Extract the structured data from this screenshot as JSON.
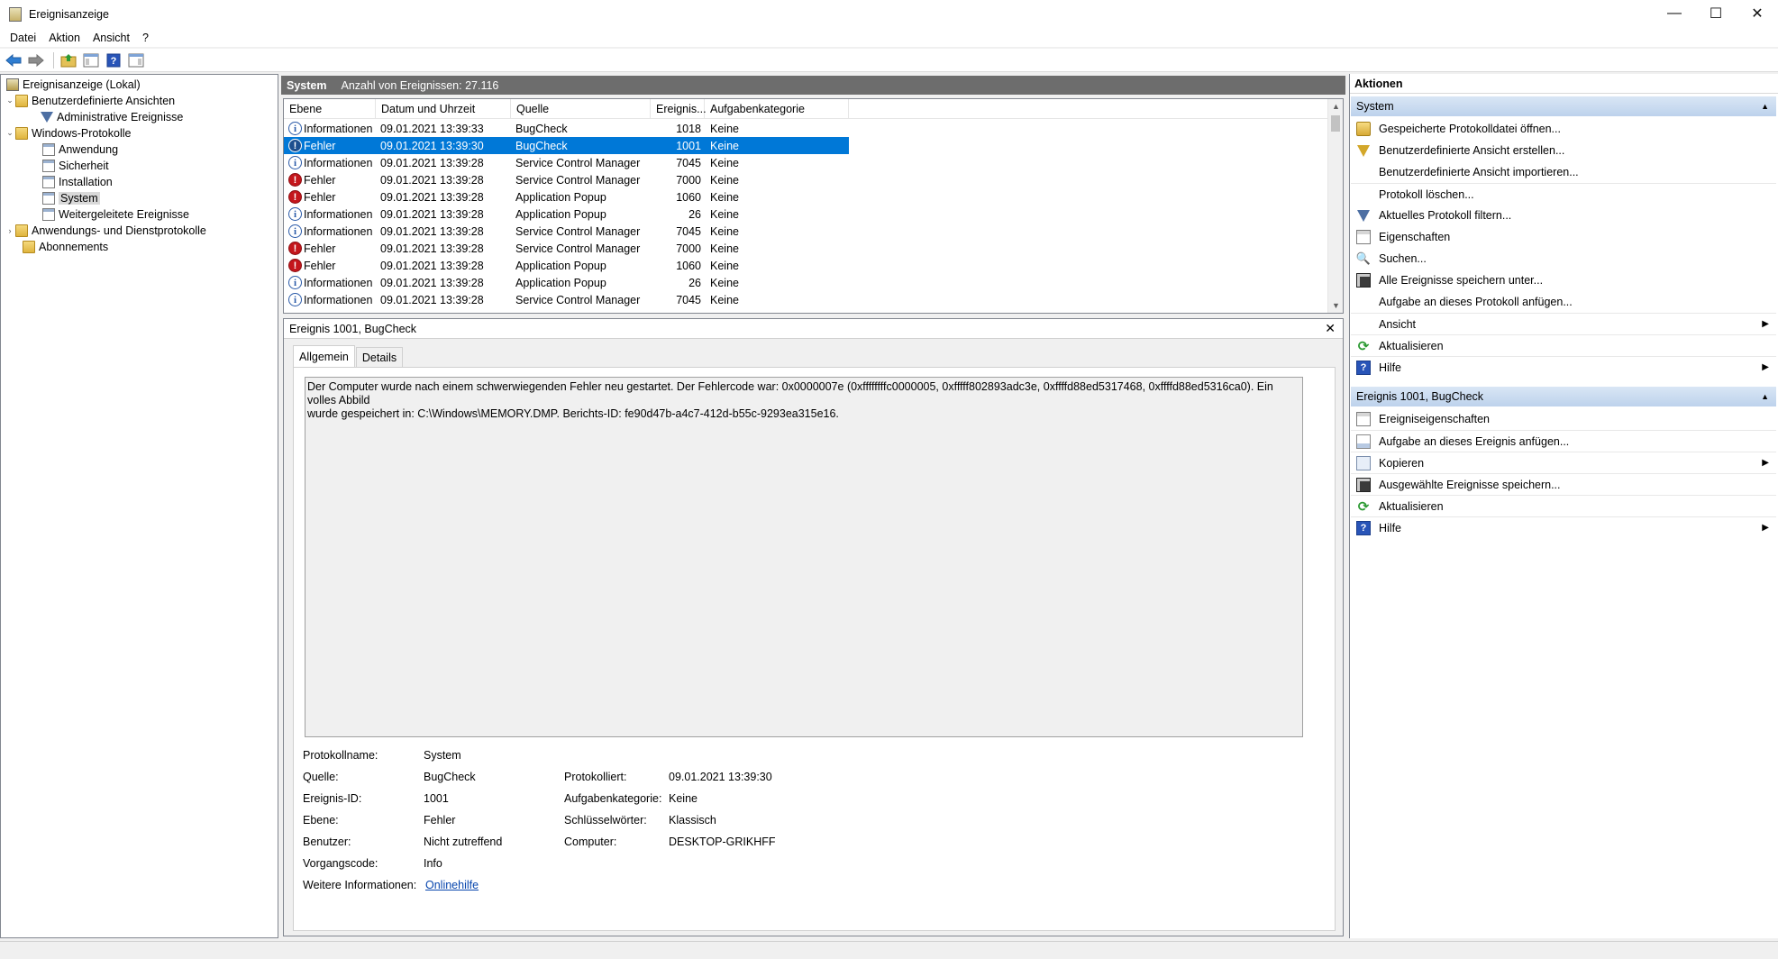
{
  "window": {
    "title": "Ereignisanzeige",
    "controls": [
      "—",
      "☐",
      "✕"
    ]
  },
  "menu": [
    "Datei",
    "Aktion",
    "Ansicht",
    "?"
  ],
  "tree": {
    "root": "Ereignisanzeige (Lokal)",
    "custom_views": "Benutzerdefinierte Ansichten",
    "admin_events": "Administrative Ereignisse",
    "windows_logs": "Windows-Protokolle",
    "application": "Anwendung",
    "security": "Sicherheit",
    "setup": "Installation",
    "system": "System",
    "forwarded": "Weitergeleitete Ereignisse",
    "app_service_logs": "Anwendungs- und Dienstprotokolle",
    "subscriptions": "Abonnements"
  },
  "center": {
    "title": "System",
    "count": "Anzahl von Ereignissen: 27.116"
  },
  "events": {
    "columns": [
      "Ebene",
      "Datum und Uhrzeit",
      "Quelle",
      "Ereignis...",
      "Aufgabenkategorie"
    ],
    "rows": [
      {
        "level": "Informationen",
        "type": "info",
        "date": "09.01.2021 13:39:33",
        "source": "BugCheck",
        "id": "1018",
        "category": "Keine"
      },
      {
        "level": "Fehler",
        "type": "error",
        "date": "09.01.2021 13:39:30",
        "source": "BugCheck",
        "id": "1001",
        "category": "Keine"
      },
      {
        "level": "Informationen",
        "type": "info",
        "date": "09.01.2021 13:39:28",
        "source": "Service Control Manager",
        "id": "7045",
        "category": "Keine"
      },
      {
        "level": "Fehler",
        "type": "error",
        "date": "09.01.2021 13:39:28",
        "source": "Service Control Manager",
        "id": "7000",
        "category": "Keine"
      },
      {
        "level": "Fehler",
        "type": "error",
        "date": "09.01.2021 13:39:28",
        "source": "Application Popup",
        "id": "1060",
        "category": "Keine"
      },
      {
        "level": "Informationen",
        "type": "info",
        "date": "09.01.2021 13:39:28",
        "source": "Application Popup",
        "id": "26",
        "category": "Keine"
      },
      {
        "level": "Informationen",
        "type": "info",
        "date": "09.01.2021 13:39:28",
        "source": "Service Control Manager",
        "id": "7045",
        "category": "Keine"
      },
      {
        "level": "Fehler",
        "type": "error",
        "date": "09.01.2021 13:39:28",
        "source": "Service Control Manager",
        "id": "7000",
        "category": "Keine"
      },
      {
        "level": "Fehler",
        "type": "error",
        "date": "09.01.2021 13:39:28",
        "source": "Application Popup",
        "id": "1060",
        "category": "Keine"
      },
      {
        "level": "Informationen",
        "type": "info",
        "date": "09.01.2021 13:39:28",
        "source": "Application Popup",
        "id": "26",
        "category": "Keine"
      },
      {
        "level": "Informationen",
        "type": "info",
        "date": "09.01.2021 13:39:28",
        "source": "Service Control Manager",
        "id": "7045",
        "category": "Keine"
      }
    ],
    "selected_index": 1
  },
  "detail": {
    "title": "Ereignis 1001, BugCheck",
    "tabs": [
      "Allgemein",
      "Details"
    ],
    "description_line1": "Der Computer wurde nach einem schwerwiegenden Fehler neu gestartet. Der Fehlercode war: 0x0000007e (0xffffffffc0000005, 0xfffff802893adc3e, 0xffffd88ed5317468, 0xffffd88ed5316ca0). Ein volles Abbild",
    "description_line2": "wurde gespeichert in: C:\\Windows\\MEMORY.DMP. Berichts-ID: fe90d47b-a4c7-412d-b55c-9293ea315e16.",
    "labels": {
      "log_name": "Protokollname:",
      "source": "Quelle:",
      "event_id": "Ereignis-ID:",
      "level": "Ebene:",
      "user": "Benutzer:",
      "opcode": "Vorgangscode:",
      "more_info": "Weitere Informationen:",
      "logged": "Protokolliert:",
      "task_category": "Aufgabenkategorie:",
      "keywords": "Schlüsselwörter:",
      "computer": "Computer:"
    },
    "values": {
      "log_name": "System",
      "source": "BugCheck",
      "event_id": "1001",
      "level": "Fehler",
      "user": "Nicht zutreffend",
      "opcode": "Info",
      "more_info": "Onlinehilfe",
      "logged": "09.01.2021 13:39:30",
      "task_category": "Keine",
      "keywords": "Klassisch",
      "computer": "DESKTOP-GRIKHFF"
    }
  },
  "actions": {
    "header": "Aktionen",
    "group1": "System",
    "group1_items": [
      {
        "label": "Gespeicherte Protokolldatei öffnen...",
        "icon": "open-icon"
      },
      {
        "label": "Benutzerdefinierte Ansicht erstellen...",
        "icon": "create-view-icon"
      },
      {
        "label": "Benutzerdefinierte Ansicht importieren...",
        "icon": ""
      },
      {
        "label": "Protokoll löschen...",
        "icon": ""
      },
      {
        "label": "Aktuelles Protokoll filtern...",
        "icon": "filter-icon"
      },
      {
        "label": "Eigenschaften",
        "icon": "properties-icon"
      },
      {
        "label": "Suchen...",
        "icon": "find-icon"
      },
      {
        "label": "Alle Ereignisse speichern unter...",
        "icon": "save-icon"
      },
      {
        "label": "Aufgabe an dieses Protokoll anfügen...",
        "icon": ""
      },
      {
        "label": "Ansicht",
        "icon": "",
        "submenu": true
      },
      {
        "label": "Aktualisieren",
        "icon": "refresh-icon"
      },
      {
        "label": "Hilfe",
        "icon": "help-icon",
        "submenu": true
      }
    ],
    "group2": "Ereignis 1001, BugCheck",
    "group2_items": [
      {
        "label": "Ereigniseigenschaften",
        "icon": "event-properties-icon"
      },
      {
        "label": "Aufgabe an dieses Ereignis anfügen...",
        "icon": "task-icon"
      },
      {
        "label": "Kopieren",
        "icon": "copy-icon",
        "submenu": true
      },
      {
        "label": "Ausgewählte Ereignisse speichern...",
        "icon": "save-icon"
      },
      {
        "label": "Aktualisieren",
        "icon": "refresh-icon"
      },
      {
        "label": "Hilfe",
        "icon": "help-icon",
        "submenu": true
      }
    ]
  },
  "colors": {
    "selection": "#0078d7",
    "header_bg": "#6d6d6d",
    "group_bg": "#c8daf0"
  }
}
